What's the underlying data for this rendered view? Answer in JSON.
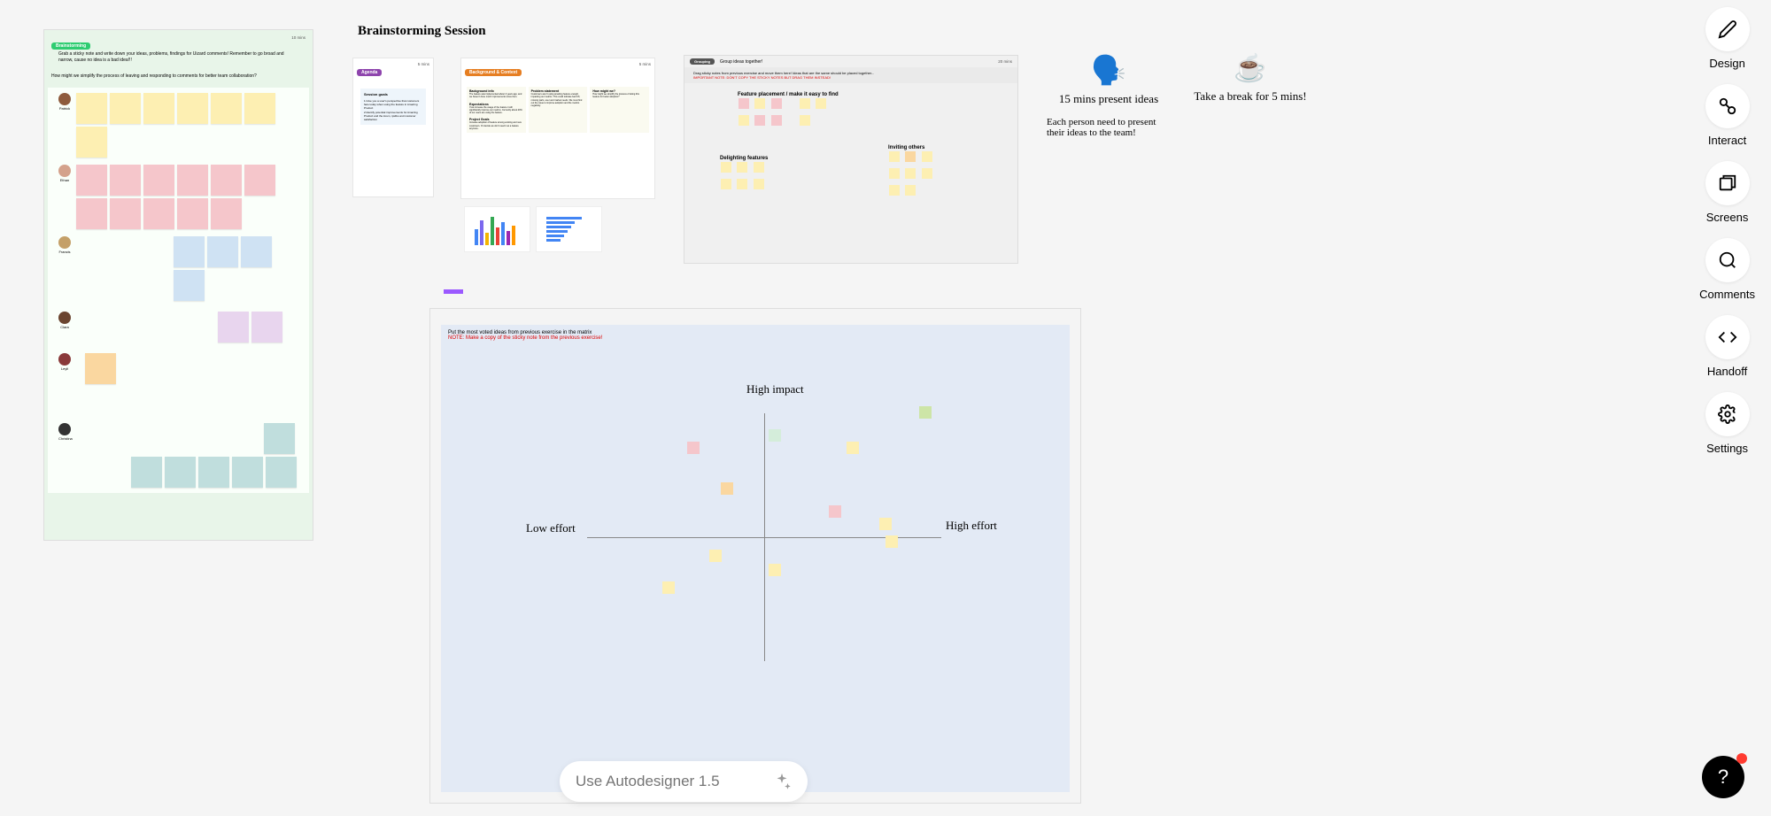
{
  "toolbar": {
    "design": "Design",
    "interact": "Interact",
    "screens": "Screens",
    "comments": "Comments",
    "handoff": "Handoff",
    "settings": "Settings"
  },
  "prompt": {
    "placeholder": "Use Autodesigner 1.5"
  },
  "help_label": "?",
  "title_main": "Brainstorming Session",
  "board_left": {
    "badge": "Brainstorming",
    "instructions": "Grab a sticky note and write down your ideas, problems, findings for Uizard comments! Remember to go broad and narrow, cause no idea is a bad idea!!!",
    "timer": "10 mins",
    "question": "How might we simplify the process of leaving and responding to comments for better team collaboration?",
    "people": [
      {
        "name": "Patrick",
        "color": "yellow",
        "count": 7
      },
      {
        "name": "Ethan",
        "color": "pink",
        "count": 11
      },
      {
        "name": "Francis",
        "color": "blue",
        "count": 4
      },
      {
        "name": "Clara",
        "color": "lavender",
        "count": 2
      },
      {
        "name": "Leyli",
        "color": "orange",
        "count": 1
      },
      {
        "name": "Christina",
        "color": "teal",
        "count": 6
      }
    ]
  },
  "board_agenda": {
    "badge": "Agenda",
    "timer": "5 mins",
    "card_title": "Session goals",
    "card_body": "1.Give you a user's perspective that customers face today when using the feature in Amazing Product\n2.Identify potential improvements for Amazing Product and the lorem, ipsilko and customer satisfaction"
  },
  "board_bg": {
    "badge": "Background & Context",
    "timer": "5 mins",
    "col1_title": "Background info",
    "col1_body": "The feature was implemented about 2 years ago, and we haven't done much improvements since then.",
    "col1_exp_title": "Expectations",
    "col1_exp_body": "If we increase the usage of the feature it will significantly improve our metrics. Currently about 20% of our users are using the feature.",
    "col1_pg_title": "Project Goals",
    "col1_pg_body": "Increase adoption of feature among existing and new customers. Or decide we don't need it as a feature anymore.",
    "col2_title": "Problem statement",
    "col2_body": "Customers aren't using amazing feature enough, impacting our metrics. This could indicate bad UX, missing parts, user and market needs. We must find out the issue to improve adoption and the metrics negativity.",
    "col3_title": "How might we?",
    "col3_body": "How might we simplify the process of doing this feature for better adoption?"
  },
  "board_group": {
    "badge": "Grouping",
    "header": "Group ideas together!",
    "timer": "20 mins",
    "instr": "Drag sticky notes from previous exercise and move them here! Ideas that are the same should be placed together...",
    "instr_red": "IMPORTANT NOTE: DON'T COPY THE STICKY NOTES BUT DRAG THEM INSTEAD!",
    "cluster1": "Feature placement / make it easy to find",
    "cluster2": "Delighting features",
    "cluster3": "Inviting others"
  },
  "notes": {
    "present_title": "15 mins present ideas",
    "present_body": "Each person need to present their ideas to the team!",
    "present_emoji": "🗣️",
    "break_title": "Take a break for 5 mins!",
    "break_emoji": "☕"
  },
  "board_matrix": {
    "instr": "Put the most voted ideas from previous exercise in the matrix",
    "instr_red": "NOTE: Make a copy of the sticky note from the previous exercise!",
    "high_impact": "High impact",
    "low_effort": "Low effort",
    "high_effort": "High effort"
  }
}
